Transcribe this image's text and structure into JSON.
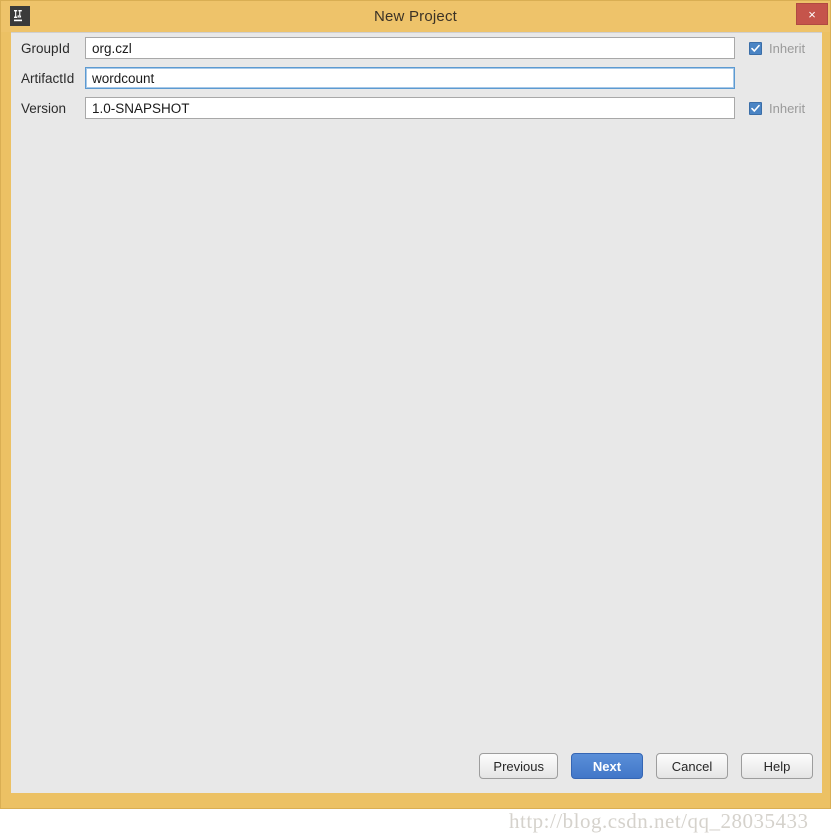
{
  "window": {
    "title": "New Project",
    "app_icon": "intellij-idea-icon",
    "frame_color": "#ecc164",
    "titlebar_color": "#eec36a",
    "body_color": "#e8e8e8",
    "close_button": {
      "label": "×",
      "icon": "close-icon",
      "color": "#c5544b"
    }
  },
  "form": {
    "fields": [
      {
        "label": "GroupId",
        "value": "org.czl",
        "placeholder": "",
        "focused": false,
        "inherit": {
          "label": "Inherit",
          "checked": true,
          "enabled": false
        }
      },
      {
        "label": "ArtifactId",
        "value": "wordcount",
        "placeholder": "",
        "focused": true,
        "inherit": null
      },
      {
        "label": "Version",
        "value": "1.0-SNAPSHOT",
        "placeholder": "",
        "focused": false,
        "inherit": {
          "label": "Inherit",
          "checked": true,
          "enabled": false
        }
      }
    ]
  },
  "footer": {
    "buttons": [
      {
        "label": "Previous",
        "default": false
      },
      {
        "label": "Next",
        "default": true
      },
      {
        "label": "Cancel",
        "default": false
      },
      {
        "label": "Help",
        "default": false
      }
    ],
    "accent_color": "#4277c8"
  },
  "watermark": {
    "text": "http://blog.csdn.net/qq_28035433"
  }
}
